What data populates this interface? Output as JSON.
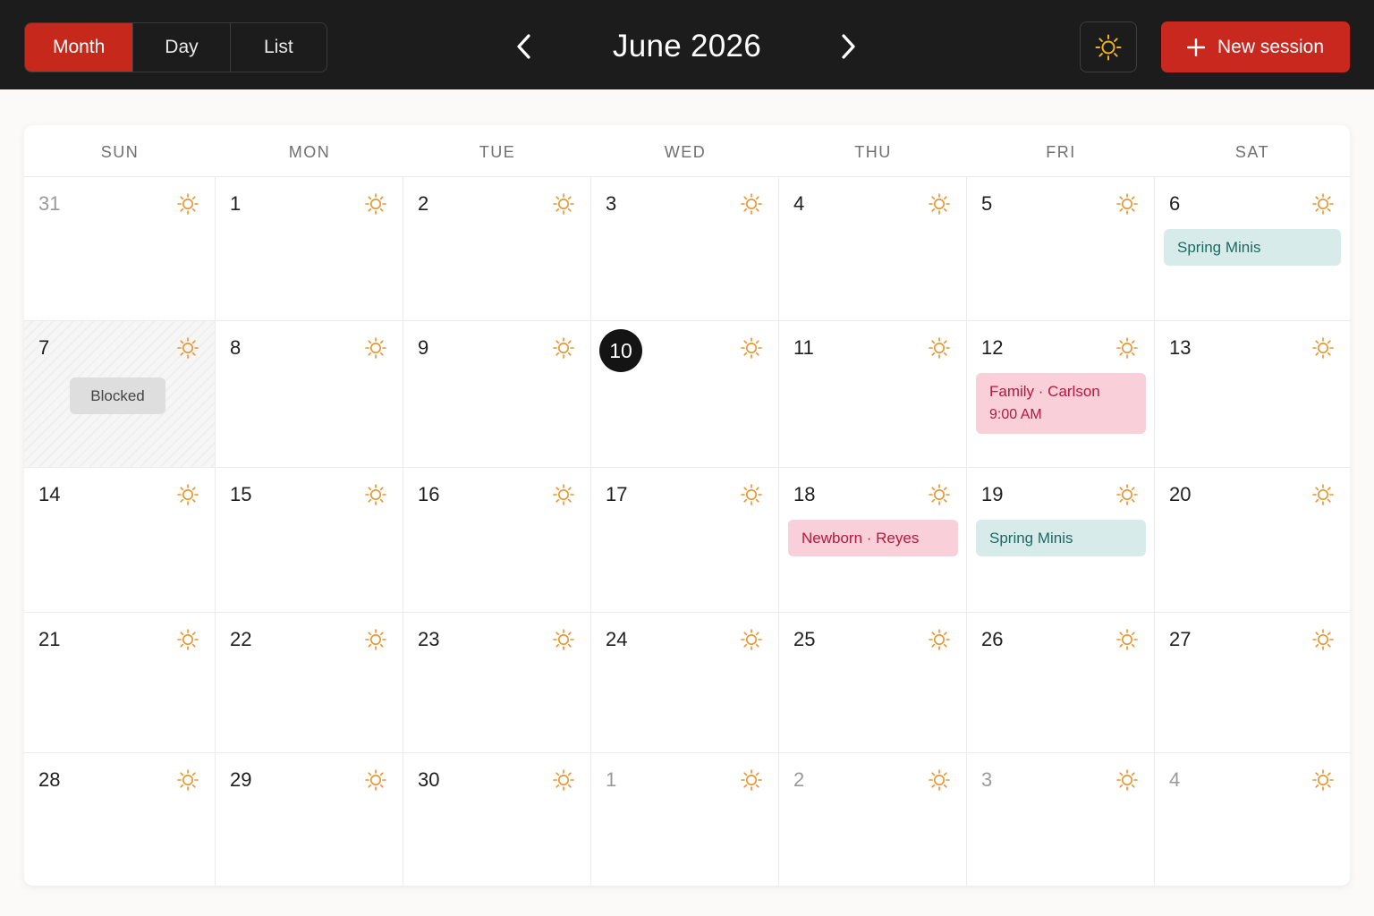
{
  "header": {
    "views": [
      {
        "label": "Month",
        "active": true
      },
      {
        "label": "Day",
        "active": false
      },
      {
        "label": "List",
        "active": false
      }
    ],
    "title": "June 2026",
    "prev_icon": "chevron-left-icon",
    "next_icon": "chevron-right-icon",
    "theme_icon": "sun-icon",
    "new_button_label": "New session",
    "new_button_icon": "plus-icon"
  },
  "colors": {
    "accent": "#c8281d",
    "topbar": "#1c1c1c",
    "sun": "#e8932b",
    "theme_sun": "#f0b21f",
    "teal_event_bg": "#d7ecea",
    "pink_event_bg": "#f9cfd9"
  },
  "calendar": {
    "weekdays": [
      "SUN",
      "MON",
      "TUE",
      "WED",
      "THU",
      "FRI",
      "SAT"
    ],
    "weeks": [
      [
        {
          "day": "31",
          "other_month": true
        },
        {
          "day": "1"
        },
        {
          "day": "2"
        },
        {
          "day": "3"
        },
        {
          "day": "4"
        },
        {
          "day": "5"
        },
        {
          "day": "6",
          "events": [
            {
              "title": "Spring Minis",
              "style": "teal"
            }
          ]
        }
      ],
      [
        {
          "day": "7",
          "blocked": true,
          "blocked_label": "Blocked"
        },
        {
          "day": "8"
        },
        {
          "day": "9"
        },
        {
          "day": "10",
          "today": true
        },
        {
          "day": "11"
        },
        {
          "day": "12",
          "events": [
            {
              "title": "Family · Carlson",
              "time": "9:00 AM",
              "style": "pink"
            }
          ]
        },
        {
          "day": "13"
        }
      ],
      [
        {
          "day": "14"
        },
        {
          "day": "15"
        },
        {
          "day": "16"
        },
        {
          "day": "17"
        },
        {
          "day": "18",
          "events": [
            {
              "title": "Newborn · Reyes",
              "style": "pink"
            }
          ]
        },
        {
          "day": "19",
          "events": [
            {
              "title": "Spring Minis",
              "style": "teal"
            }
          ]
        },
        {
          "day": "20"
        }
      ],
      [
        {
          "day": "21"
        },
        {
          "day": "22"
        },
        {
          "day": "23"
        },
        {
          "day": "24"
        },
        {
          "day": "25"
        },
        {
          "day": "26"
        },
        {
          "day": "27"
        }
      ],
      [
        {
          "day": "28"
        },
        {
          "day": "29"
        },
        {
          "day": "30"
        },
        {
          "day": "1",
          "other_month": true
        },
        {
          "day": "2",
          "other_month": true
        },
        {
          "day": "3",
          "other_month": true
        },
        {
          "day": "4",
          "other_month": true
        }
      ]
    ],
    "day_icon": "sun-icon"
  }
}
